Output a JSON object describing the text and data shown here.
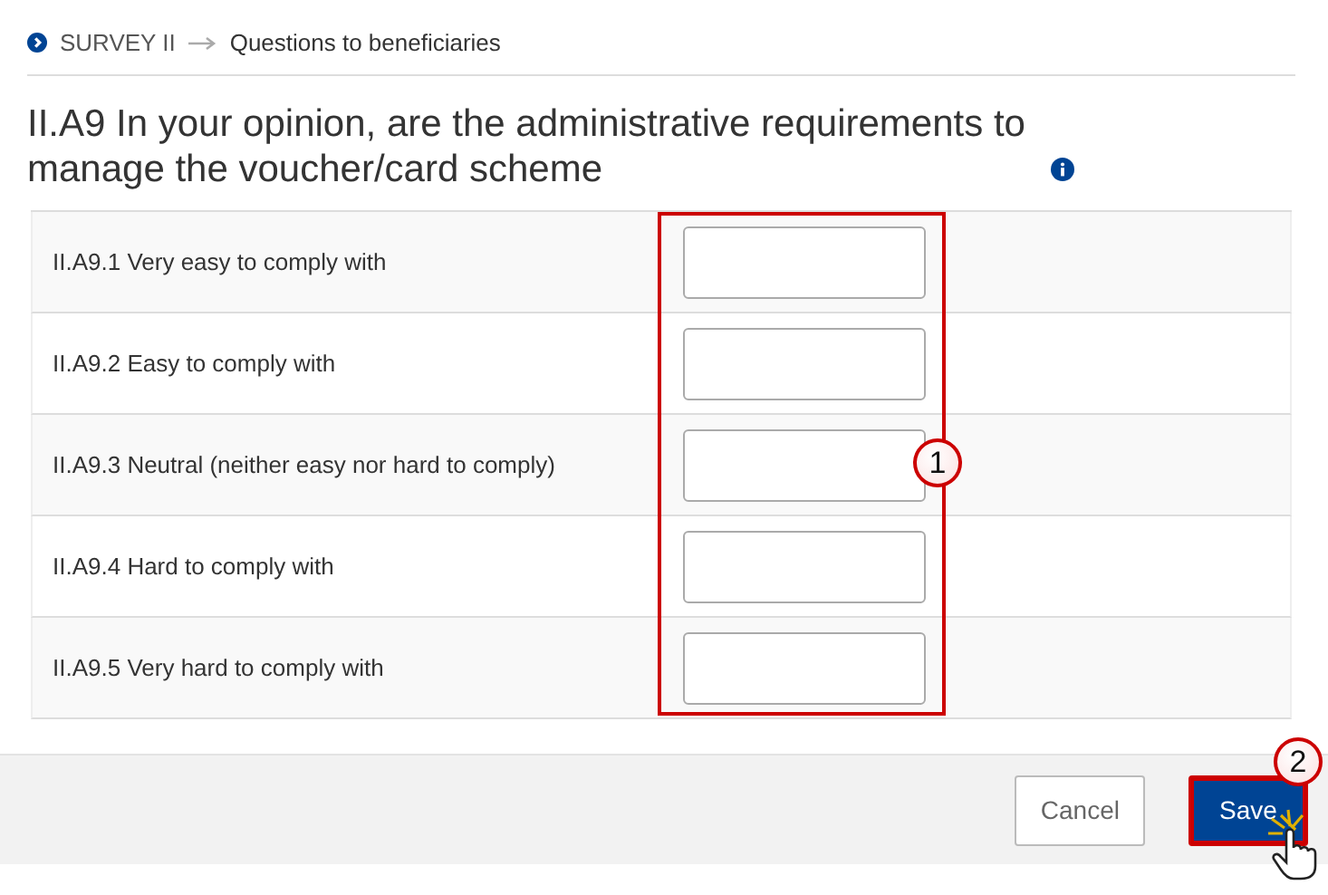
{
  "breadcrumb": {
    "parent": "SURVEY II",
    "current": "Questions to beneficiaries"
  },
  "question": {
    "title": "II.A9 In your opinion, are the administrative requirements to manage the voucher/card scheme"
  },
  "rows": [
    {
      "label": "II.A9.1 Very easy to comply with"
    },
    {
      "label": "II.A9.2 Easy to comply with"
    },
    {
      "label": "II.A9.3 Neutral (neither easy nor hard to comply)"
    },
    {
      "label": "II.A9.4 Hard to comply with"
    },
    {
      "label": "II.A9.5 Very hard to comply with"
    }
  ],
  "buttons": [
    {
      "label": "Cancel",
      "kind": "secondary"
    },
    {
      "label": "Save",
      "kind": "primary"
    }
  ],
  "annotations": [
    {
      "number": "1"
    },
    {
      "number": "2"
    }
  ]
}
